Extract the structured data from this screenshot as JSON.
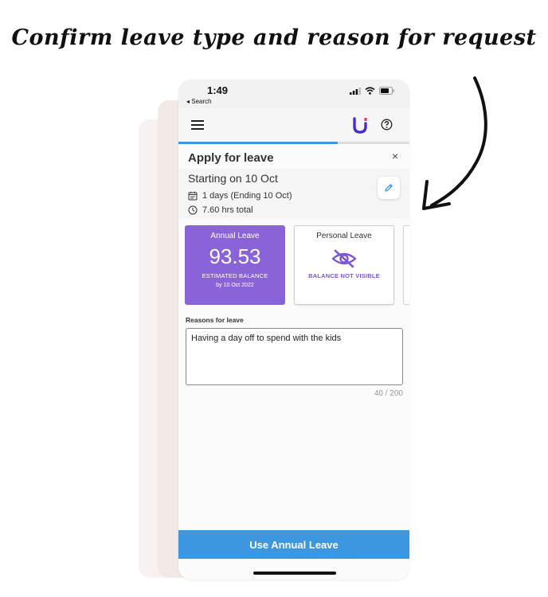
{
  "headline": "Confirm leave type and reason for request",
  "status_bar": {
    "time": "1:49",
    "back_label": "◂ Search"
  },
  "app_bar": {
    "logo_color": "#4b2bd0",
    "logo_accent": "#e43b7a"
  },
  "progress": {
    "percent": 69,
    "color": "#3d96e0"
  },
  "sheet": {
    "title": "Apply for leave",
    "close_glyph": "×"
  },
  "summary": {
    "starting": "Starting on 10 Oct",
    "days": "1 days (Ending 10 Oct)",
    "hours": "7.60 hrs total"
  },
  "leave_cards": [
    {
      "name": "Annual Leave",
      "balance": "93.53",
      "caption": "ESTIMATED BALANCE",
      "date": "by 10 Oct 2022",
      "selected": true,
      "color": "#8b63d9"
    },
    {
      "name": "Personal Leave",
      "caption": "BALANCE NOT VISIBLE",
      "icon": "eye-off-icon",
      "selected": false,
      "color": "#7d57d4"
    }
  ],
  "reasons": {
    "label": "Reasons for leave",
    "value": "Having a day off to spend with the kids",
    "count": "40 / 200"
  },
  "submit_label": "Use Annual Leave"
}
